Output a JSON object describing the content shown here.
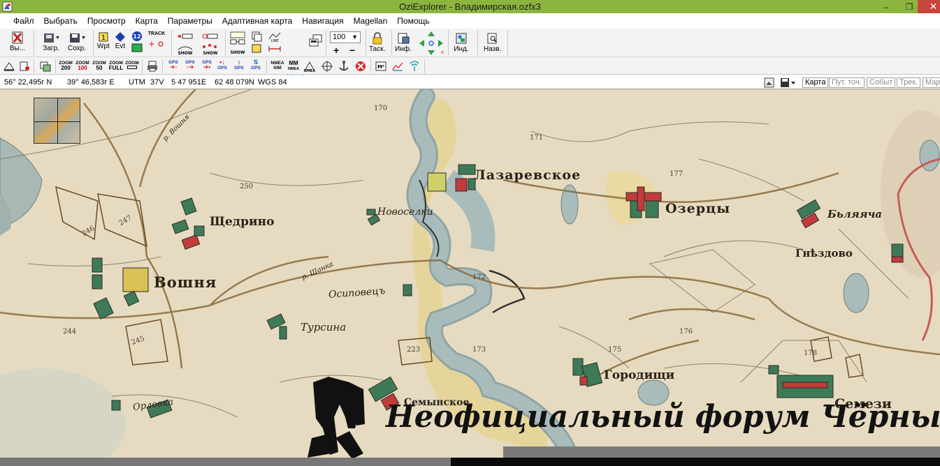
{
  "window": {
    "title": "OziExplorer - Владимирская.ozfx3",
    "minimize": "–",
    "maximize": "❐",
    "close": "✕"
  },
  "menu": [
    {
      "label": "Файл"
    },
    {
      "label": "Выбрать"
    },
    {
      "label": "Просмотр"
    },
    {
      "label": "Карта"
    },
    {
      "label": "Параметры"
    },
    {
      "label": "Адаптивная карта"
    },
    {
      "label": "Навигация"
    },
    {
      "label": "Magellan"
    },
    {
      "label": "Помощь"
    }
  ],
  "toolbar": {
    "exit_label": "Вы...",
    "load_label": "Загр.",
    "save_label": "Сохр.",
    "wpt_label": "Wpt",
    "evt_label": "Evt",
    "track_label": "TRACK",
    "show_label": "SHOW",
    "zoom_value": "100",
    "task_label": "Таск.",
    "info_label": "Инф.",
    "ind_label": "Инд.",
    "name_label": "Назв."
  },
  "toolbar2": {
    "zoom200": "200",
    "zoom100": "100",
    "zoom50": "50",
    "zoomfull": "FULL",
    "zoom_word": "ZOOM",
    "gps": "GPS",
    "nmea": "NMEA",
    "nmea_sub": "SIM",
    "mm": "MM",
    "mm_sub": "NMEA"
  },
  "status": {
    "lat": "56° 22,495г N",
    "lon": "39° 46,583г E",
    "grid": "UTM",
    "zone": "37V",
    "easting": "5 47 951E",
    "northing": "62 48 079N",
    "datum": "WGS 84"
  },
  "view_tabs": [
    {
      "label": "Карта",
      "active": true
    },
    {
      "label": "Пут. точ.",
      "active": false
    },
    {
      "label": "Событ",
      "active": false
    },
    {
      "label": "Трек.",
      "active": false
    },
    {
      "label": "Мар",
      "active": false
    }
  ],
  "map_labels": {
    "lazarevskoe": "Лазаревское",
    "ozertsy": "Озерцы",
    "byliachi": "Бьляяча",
    "gnezdovo": "Гнѣздово",
    "shchedrino": "Щедрино",
    "voshnia": "Вошня",
    "novoselki": "Новоселки",
    "osipovets": "Осиповецъ",
    "tursina": "Турсина",
    "gorodishchi": "Городищи",
    "semynskoe": "Семынское",
    "semezh": "Семези",
    "orlovka": "Орловка",
    "voshnia_river": "р. Вошня",
    "shanka": "р. Шанка"
  },
  "map_numbers": [
    "170",
    "171",
    "250",
    "177",
    "246",
    "247",
    "172",
    "244",
    "245",
    "223",
    "173",
    "175",
    "176",
    "178"
  ],
  "watermark": "Неофициальный форум Чёрных копателей",
  "colors": {
    "titlebar": "#8cb53e",
    "close": "#c7463d",
    "map_paper": "#e7dcc2",
    "river": "#9fb3b3",
    "road": "#8a6a3a",
    "village_red": "#c23b3b",
    "village_green": "#3f7a58"
  }
}
